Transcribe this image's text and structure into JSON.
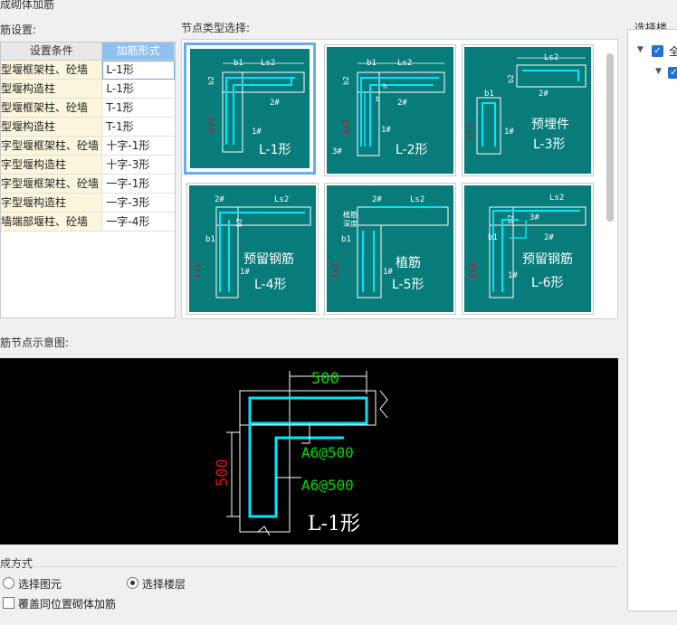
{
  "window_title": "成砌体加筋",
  "section_settings_label": "筋设置:",
  "table": {
    "headers": [
      "设置条件",
      "加筋形式"
    ],
    "rows": [
      {
        "cond": "型堰框架柱、砼墙",
        "form": "L-1形"
      },
      {
        "cond": "型堰构造柱",
        "form": "L-1形"
      },
      {
        "cond": "型堰框架柱、砼墙",
        "form": "T-1形"
      },
      {
        "cond": "型堰构造柱",
        "form": "T-1形"
      },
      {
        "cond": "字型堰框架柱、砼墙",
        "form": "十字-1形"
      },
      {
        "cond": "字型堰构造柱",
        "form": "十字-3形"
      },
      {
        "cond": "字型堰框架柱、砼墙",
        "form": "一字-1形"
      },
      {
        "cond": "字型堰构造柱",
        "form": "一字-3形"
      },
      {
        "cond": "墙端部堰柱、砼墙",
        "form": "一字-4形"
      }
    ]
  },
  "node_type_label": "节点类型选择:",
  "cards": [
    {
      "name": "L-1形",
      "b1": "b1",
      "ls2": "Ls2",
      "b2": "b2",
      "bar2": "2#",
      "bar1": "1#",
      "la": "Ls1"
    },
    {
      "name": "L-2形",
      "b1": "b1",
      "ls2": "Ls2",
      "b2": "b2",
      "bar2": "2#",
      "bar1": "1#",
      "bar3": "3#",
      "h": "h",
      "b": "b",
      "la": "Ls1"
    },
    {
      "name": "L-3形",
      "sub": "预埋件",
      "b1": "b1",
      "ls2": "Ls2",
      "b2": "b2",
      "bar2": "2#",
      "bar1": "1#",
      "la": "Ls1"
    },
    {
      "name": "L-4形",
      "sub": "预留钢筋",
      "b1": "b1",
      "ls2": "Ls2",
      "b2": "b2",
      "bar2": "2#",
      "bar1": "1#",
      "la": "Ls1"
    },
    {
      "name": "L-5形",
      "sub": "植筋",
      "b1": "b1",
      "ls2": "Ls2",
      "bar2": "2#",
      "bar1": "1#",
      "zj1": "植筋",
      "zj2": "深度",
      "la": "Ls1"
    },
    {
      "name": "L-6形",
      "sub": "预留钢筋",
      "b1": "b1",
      "ls2": "Ls2",
      "b2": "b2",
      "bar2": "2#",
      "bar3": "3#",
      "bar1": "1#",
      "la": "Ls1"
    }
  ],
  "preview_label": "筋节点示意图:",
  "preview": {
    "dim_top": "500",
    "dim_left": "500",
    "spec1": "A6@500",
    "spec2": "A6@500",
    "name": "L-1形"
  },
  "mode_label": "成方式",
  "radio1": "选择图元",
  "radio2": "选择楼层",
  "overlay_label": "覆盖同位置砌体加筋",
  "floor_label": "选择楼层",
  "floor_all": "全",
  "colors": {
    "teal": "#087b7b",
    "cyan": "#00e5ff",
    "green": "#00d800",
    "red": "#e01010",
    "accent": "#66aef0"
  }
}
